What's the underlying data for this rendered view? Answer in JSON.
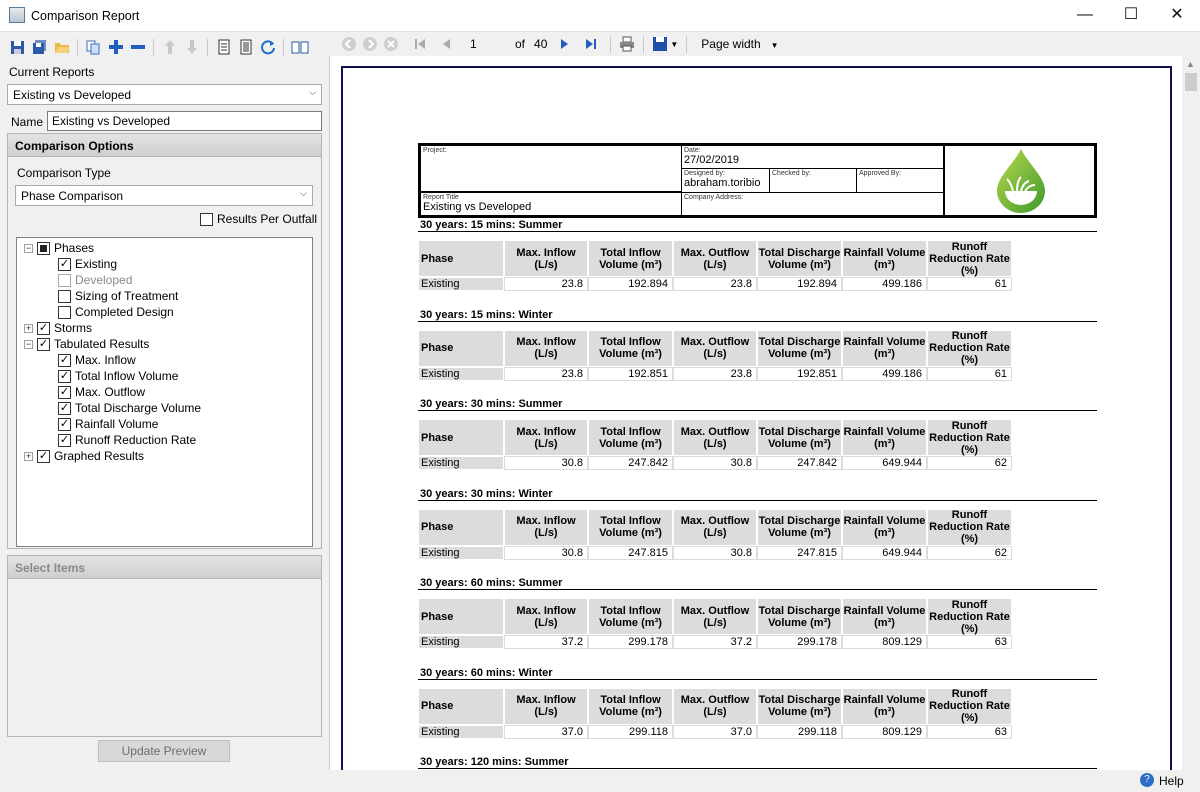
{
  "window": {
    "title": "Comparison Report",
    "min": "—",
    "max": "☐",
    "close": "✕"
  },
  "left": {
    "current_reports_label": "Current Reports",
    "current_report": "Existing vs Developed",
    "name_label": "Name",
    "name_value": "Existing vs Developed",
    "comparison_options": "Comparison Options",
    "comparison_type_label": "Comparison Type",
    "comparison_type": "Phase Comparison",
    "results_per_outfall": "Results Per Outfall",
    "tree": {
      "phases": "Phases",
      "existing": "Existing",
      "developed": "Developed",
      "sizing": "Sizing of Treatment",
      "completed": "Completed Design",
      "storms": "Storms",
      "tabulated": "Tabulated Results",
      "max_inflow": "Max. Inflow",
      "total_inflow": "Total Inflow Volume",
      "max_outflow": "Max. Outflow",
      "total_discharge": "Total Discharge Volume",
      "rainfall": "Rainfall Volume",
      "runoff": "Runoff Reduction Rate",
      "graphed": "Graphed Results"
    },
    "select_items": "Select Items",
    "update_preview": "Update Preview"
  },
  "viewer_toolbar": {
    "page": "1",
    "of": "of",
    "total": "40",
    "zoom": "Page width"
  },
  "report": {
    "project_label": "Project:",
    "date_label": "Date:",
    "date": "27/02/2019",
    "designed_label": "Designed by:",
    "designed_by": "abraham.toribio",
    "checked_label": "Checked by:",
    "approved_label": "Approved By:",
    "report_title_label": "Report Title",
    "report_title": "Existing vs Developed",
    "company_label": "Company Address:",
    "columns": [
      "Phase",
      "Max. Inflow (L/s)",
      "Total Inflow Volume (m³)",
      "Max. Outflow (L/s)",
      "Total Discharge Volume (m³)",
      "Rainfall Volume (m³)",
      "Runoff Reduction Rate (%)"
    ],
    "sections": [
      {
        "title": "30 years: 15 mins: Summer",
        "row": [
          "Existing",
          "23.8",
          "192.894",
          "23.8",
          "192.894",
          "499.186",
          "61"
        ]
      },
      {
        "title": "30 years: 15 mins: Winter",
        "row": [
          "Existing",
          "23.8",
          "192.851",
          "23.8",
          "192.851",
          "499.186",
          "61"
        ]
      },
      {
        "title": "30 years: 30 mins: Summer",
        "row": [
          "Existing",
          "30.8",
          "247.842",
          "30.8",
          "247.842",
          "649.944",
          "62"
        ]
      },
      {
        "title": "30 years: 30 mins: Winter",
        "row": [
          "Existing",
          "30.8",
          "247.815",
          "30.8",
          "247.815",
          "649.944",
          "62"
        ]
      },
      {
        "title": "30 years: 60 mins: Summer",
        "row": [
          "Existing",
          "37.2",
          "299.178",
          "37.2",
          "299.178",
          "809.129",
          "63"
        ]
      },
      {
        "title": "30 years: 60 mins: Winter",
        "row": [
          "Existing",
          "37.0",
          "299.118",
          "37.0",
          "299.118",
          "809.129",
          "63"
        ]
      },
      {
        "title": "30 years: 120 mins: Summer",
        "row": []
      }
    ]
  },
  "status": {
    "help": "Help"
  },
  "colors": {
    "accent": "#0050c8",
    "logo_green": "#6cb33f",
    "page_border": "#101050"
  }
}
